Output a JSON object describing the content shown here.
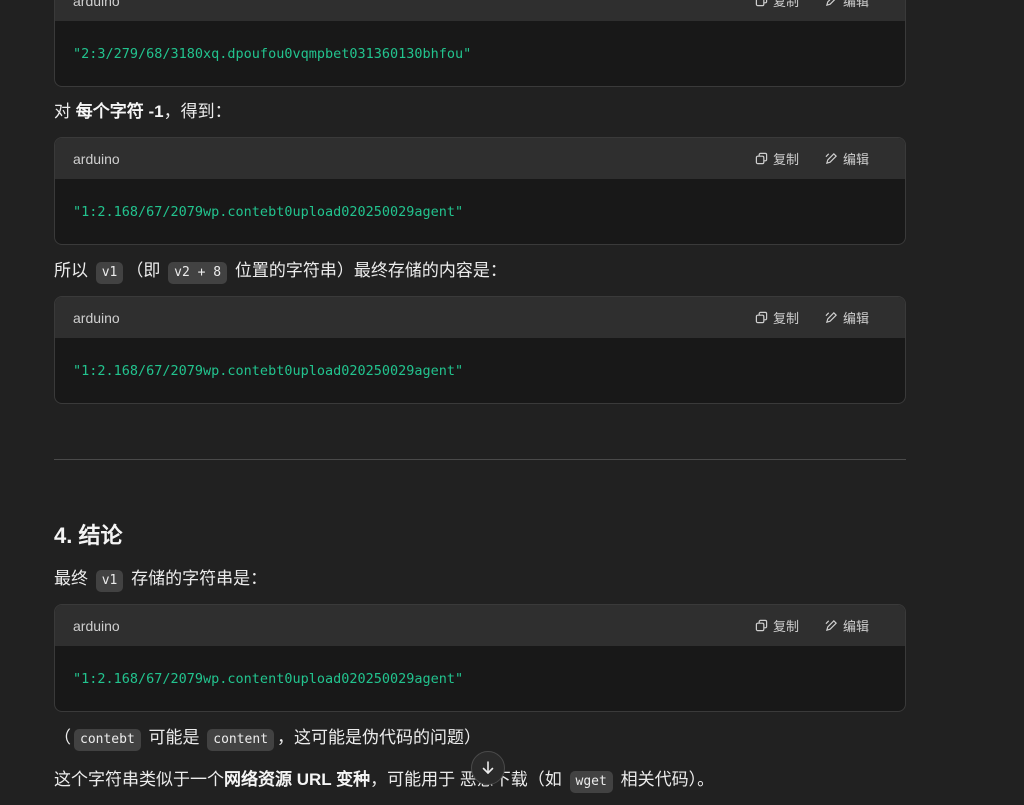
{
  "icons": {
    "copy": "copy-icon",
    "edit": "edit-icon",
    "scroll_down": "arrow-down-icon"
  },
  "colors": {
    "background": "#212121",
    "code_bg": "#181818",
    "code_header_bg": "#2f2f2f",
    "code_text": "#22c38e",
    "inline_code_bg": "#424242"
  },
  "code_blocks": [
    {
      "lang": "arduino",
      "copy": "复制",
      "edit": "编辑",
      "code": "\"2:3/279/68/3180xq.dpoufou0vqmpbet031360130bhfou\""
    },
    {
      "lang": "arduino",
      "copy": "复制",
      "edit": "编辑",
      "code": "\"1:2.168/67/2079wp.contebt0upload020250029agent\""
    },
    {
      "lang": "arduino",
      "copy": "复制",
      "edit": "编辑",
      "code": "\"1:2.168/67/2079wp.contebt0upload020250029agent\""
    },
    {
      "lang": "arduino",
      "copy": "复制",
      "edit": "编辑",
      "code": "\"1:2.168/67/2079wp.content0upload020250029agent\""
    }
  ],
  "para1": {
    "pre": "对 ",
    "bold": "每个字符 -1",
    "post": "，得到："
  },
  "para2": {
    "pre": "所以 ",
    "code1": "v1",
    "mid1": "（即 ",
    "code2": "v2 + 8",
    "post": " 位置的字符串）最终存储的内容是："
  },
  "heading": "4. 结论",
  "para3": {
    "pre": "最终 ",
    "code1": "v1",
    "post": " 存储的字符串是："
  },
  "para4": {
    "pre": "（",
    "code1": "contebt",
    "mid": " 可能是 ",
    "code2": "content",
    "post": "，这可能是伪代码的问题）"
  },
  "para5": {
    "pre": "这个字符串类似于一个",
    "bold": "网络资源 URL 变种",
    "mid": "，可能用于 恶意下载（如 ",
    "code1": "wget",
    "post": " 相关代码）。"
  }
}
